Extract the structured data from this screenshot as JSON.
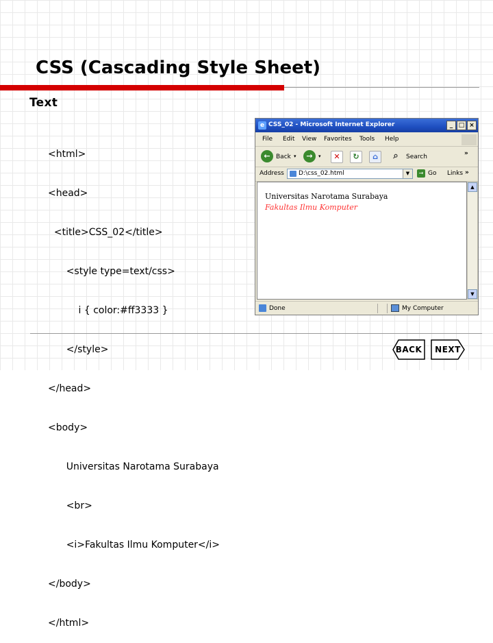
{
  "slide": {
    "title": "CSS (Cascading Style Sheet)",
    "bullet": "Text",
    "code_lines": [
      "<html>",
      "<head>",
      "  <title>CSS_02</title>",
      "      <style type=text/css>",
      "          i { color:#ff3333 }",
      "      </style>",
      "</head>",
      "<body>",
      "      Universitas Narotama Surabaya",
      "      <br>",
      "      <i>Fakultas Ilmu Komputer</i>",
      "</body>",
      "</html>"
    ]
  },
  "browser": {
    "window_title": "CSS_02 - Microsoft Internet Explorer",
    "menu": [
      "File",
      "Edit",
      "View",
      "Favorites",
      "Tools",
      "Help"
    ],
    "toolbar": {
      "back": "Back",
      "search": "Search"
    },
    "address": {
      "label": "Address",
      "value": "D:\\css_02.html",
      "go": "Go",
      "links": "Links"
    },
    "content": {
      "line1": "Universitas Narotama Surabaya",
      "line2": "Fakultas Ilmu Komputer",
      "line2_color": "#ff3333"
    },
    "status": {
      "left": "Done",
      "right": "My Computer"
    }
  },
  "nav": {
    "back": "BACK",
    "next": "NEXT"
  },
  "colors": {
    "accent_red": "#d40000",
    "ie_title_blue": "#1f4fc0"
  }
}
